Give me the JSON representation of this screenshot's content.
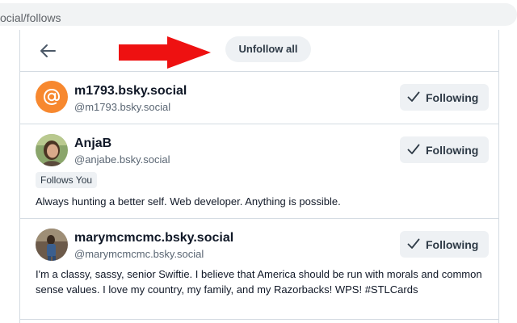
{
  "browser": {
    "url": "ocial/follows"
  },
  "header": {
    "unfollow_all_label": "Unfollow all"
  },
  "colors": {
    "annotation_arrow": "#ee1111",
    "accent": "#f7882f"
  },
  "follows": [
    {
      "display_name": "m1793.bsky.social",
      "handle": "@m1793.bsky.social",
      "button_label": "Following",
      "avatar_icon": "at-sign-icon"
    },
    {
      "display_name": "AnjaB",
      "handle": "@anjabe.bsky.social",
      "badge": "Follows You",
      "bio": "Always hunting a better self. Web developer. Anything is possible.",
      "button_label": "Following"
    },
    {
      "display_name": "marymcmcmc.bsky.social",
      "handle": "@marymcmcmc.bsky.social",
      "bio": "I'm a classy, sassy, senior Swiftie. I believe that America should be run with morals and common sense values. I love my country, my family, and my Razorbacks! WPS! #STLCards",
      "button_label": "Following"
    }
  ]
}
